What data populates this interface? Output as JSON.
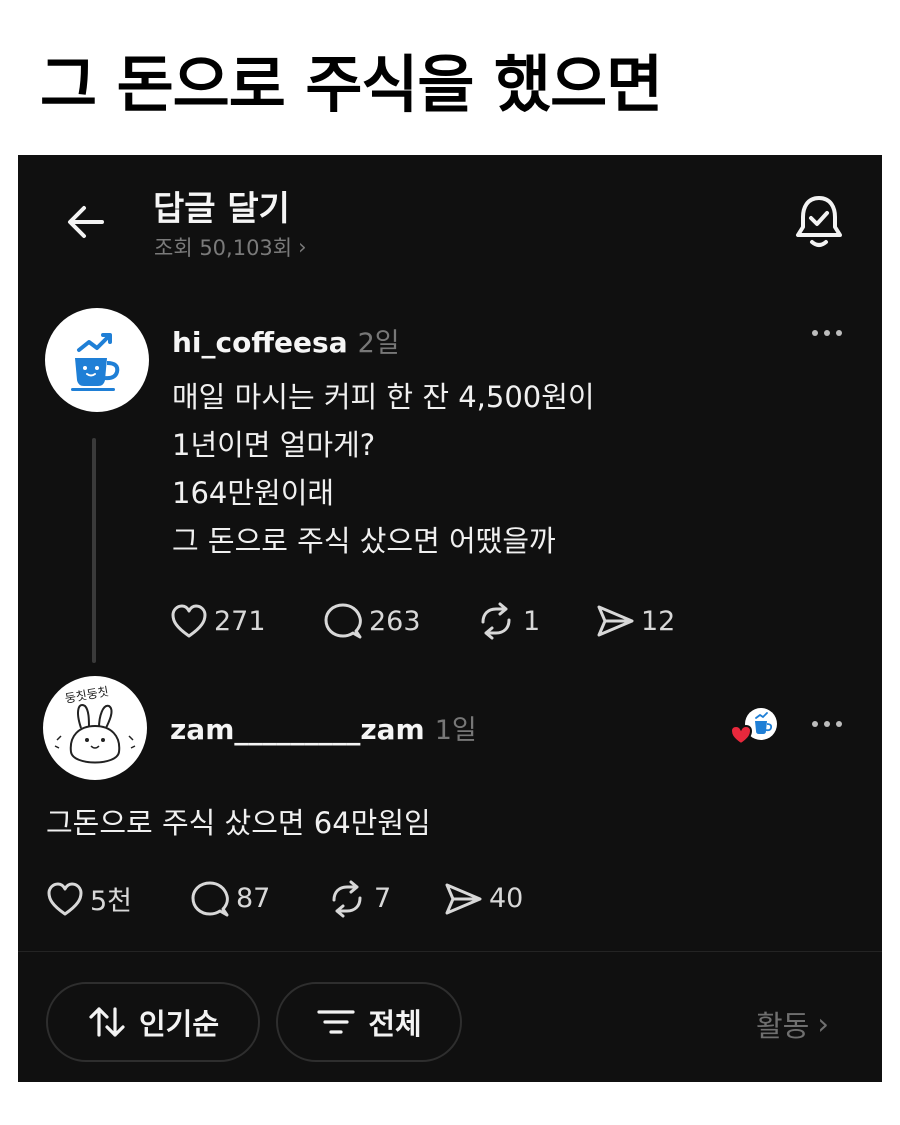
{
  "headline": "그 돈으로 주식을 했으면",
  "header": {
    "title": "답글 달기",
    "views": "조회 50,103회",
    "views_arrow": "›"
  },
  "post": {
    "username": "hi_coffeesa",
    "time": "2일",
    "lines": [
      "매일 마시는 커피 한 잔 4,500원이",
      "1년이면 얼마게?",
      "164만원이래",
      "그 돈으로 주식 샀으면 어땠을까"
    ],
    "likes": "271",
    "comments": "263",
    "reposts": "1",
    "shares": "12"
  },
  "reply": {
    "username": "zam_________zam",
    "time": "1일",
    "text": "그돈으로 주식 샀으면 64만원임",
    "likes": "5천",
    "comments": "87",
    "reposts": "7",
    "shares": "40"
  },
  "footer": {
    "sort_label": "인기순",
    "filter_label": "전체",
    "activity_label": "활동",
    "activity_arrow": "›"
  },
  "colors": {
    "background": "#101010",
    "text": "#f3f3f3",
    "muted": "#777777",
    "heart": "#e8283c",
    "coffee_blue": "#1f7fd6"
  },
  "icons": {
    "back": "arrow-left-icon",
    "bell": "bell-check-icon",
    "like": "heart-icon",
    "comment": "comment-bubble-icon",
    "repost": "repost-icon",
    "share": "send-icon",
    "sort": "sort-arrows-icon",
    "filter": "filter-lines-icon"
  }
}
